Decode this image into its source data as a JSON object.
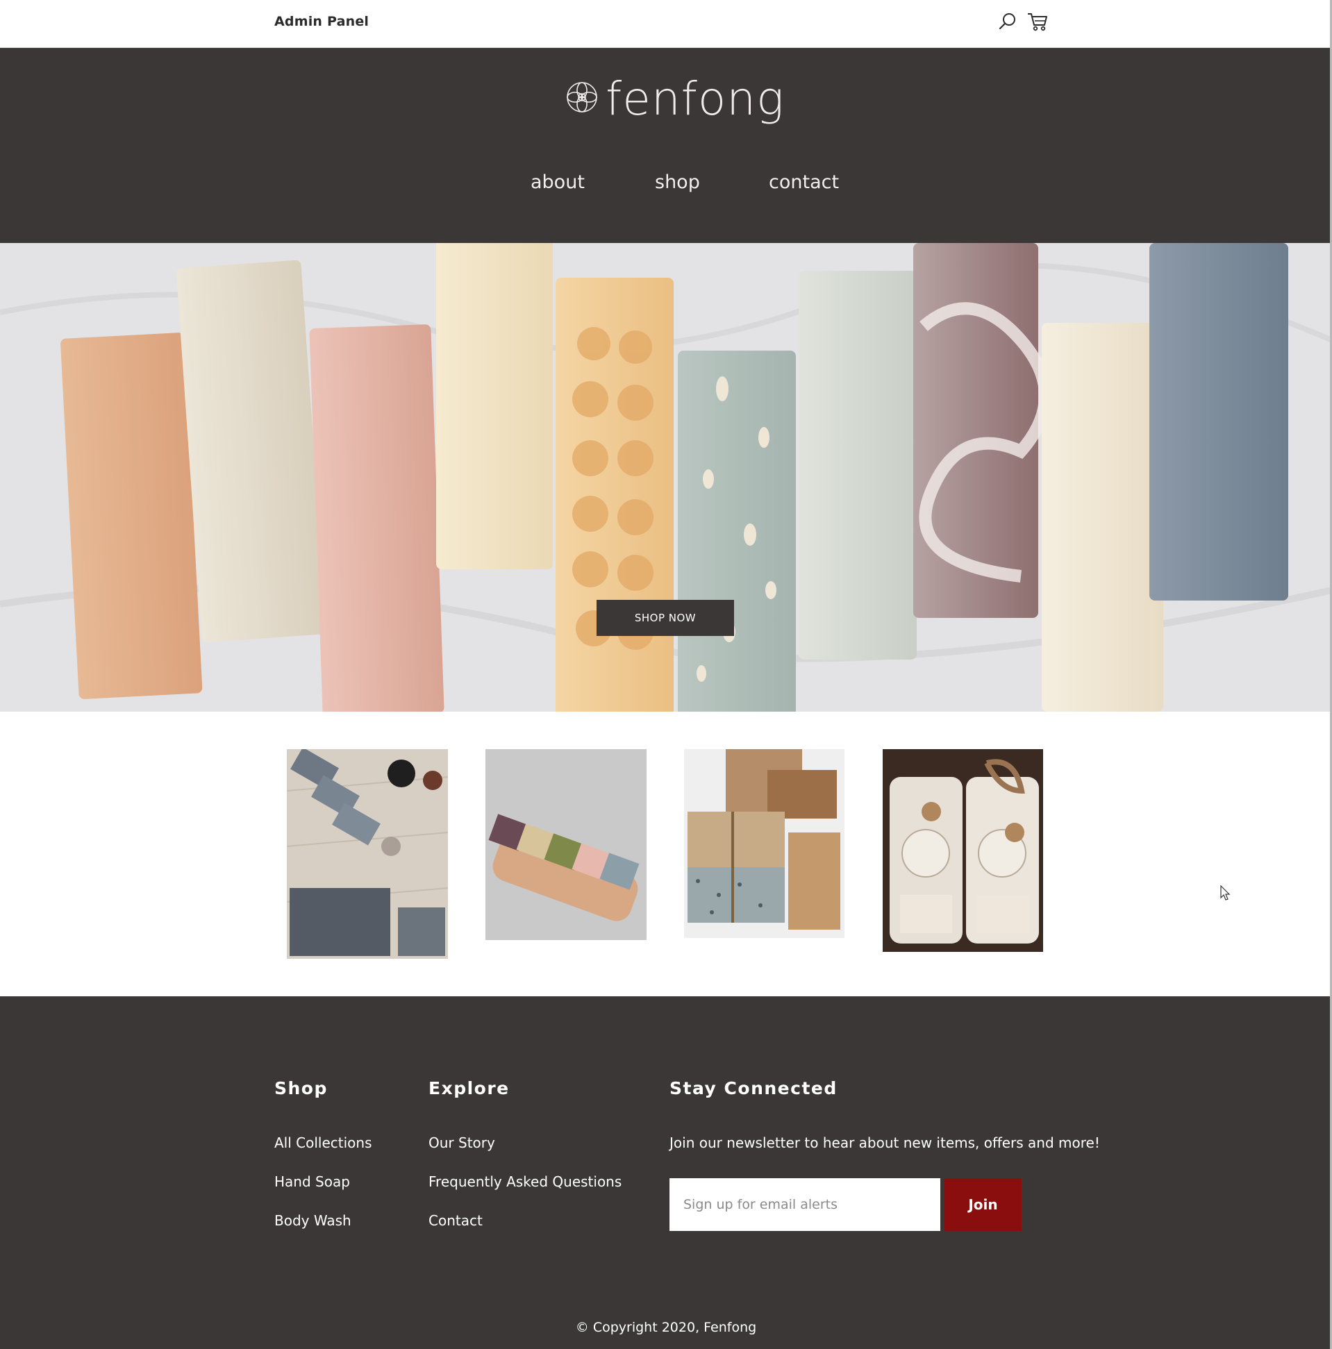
{
  "topbar": {
    "admin_label": "Admin Panel"
  },
  "brand": {
    "name": "fenfong"
  },
  "nav": {
    "items": [
      "about",
      "shop",
      "contact"
    ]
  },
  "hero": {
    "cta_label": "SHOP NOW"
  },
  "footer": {
    "shop_heading": "Shop",
    "shop_links": [
      "All Collections",
      "Hand Soap",
      "Body Wash"
    ],
    "explore_heading": "Explore",
    "explore_links": [
      "Our Story",
      "Frequently Asked Questions",
      "Contact"
    ],
    "connect_heading": "Stay Connected",
    "newsletter_text": "Join our newsletter to hear about new items, offers and more!",
    "email_placeholder": "Sign up for email alerts",
    "join_label": "Join",
    "copyright": "© Copyright 2020, Fenfong"
  },
  "colors": {
    "header_bg": "#3b3737",
    "footer_bg": "#3b3737",
    "join_button": "#8b0e0e",
    "text_light": "#ffffff"
  },
  "icons": [
    "search-icon",
    "cart-icon",
    "flower-logo-icon",
    "cursor-icon"
  ]
}
